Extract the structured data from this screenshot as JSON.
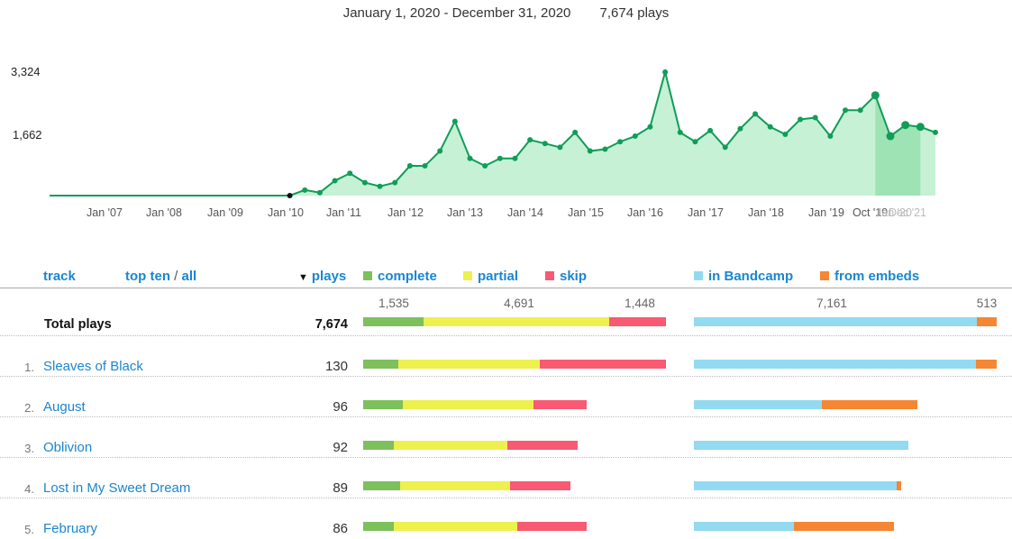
{
  "header": {
    "date_range": "January 1, 2020 - December 31, 2020",
    "plays_label": "7,674 plays"
  },
  "chart_data": {
    "type": "area",
    "y_ticks": [
      "3,324",
      "1,662"
    ],
    "x_ticks": [
      "Jan '07",
      "Jan '08",
      "Jan '09",
      "Jan '10",
      "Jan '11",
      "Jan '12",
      "Jan '13",
      "Jan '14",
      "Jan '15",
      "Jan '16",
      "Jan '17",
      "Jan '18",
      "Jan '19",
      "Oct '19"
    ],
    "x_ticks_faded": [
      "Jan '20",
      "Dec '21"
    ],
    "ylim": [
      0,
      3324
    ],
    "series": [
      {
        "values": [
          0,
          0,
          0,
          0,
          0,
          0,
          0,
          0,
          0,
          0,
          0,
          0,
          0,
          0,
          0,
          0,
          0,
          150,
          80,
          400,
          600,
          350,
          250,
          350,
          800,
          800,
          1200,
          2000,
          1000,
          800,
          1000,
          1000,
          1500,
          1400,
          1300,
          1700,
          1200,
          1250,
          1450,
          1600,
          1850,
          3324,
          1700,
          1450,
          1750,
          1300,
          1800,
          2200,
          1850,
          1650,
          2050,
          2100,
          1600,
          2300,
          2300,
          2700,
          1600,
          1900,
          1850,
          1700
        ],
        "selected_range_start_index": 55,
        "selected_range_end_index": 58,
        "color": "#0f9d58",
        "fill": "#c6f1d5",
        "selected_fill": "#9ee3b4"
      }
    ]
  },
  "table": {
    "headers": {
      "track": "track",
      "top_ten": "top ten",
      "slash": "/",
      "all": "all",
      "plays": "plays",
      "complete": "complete",
      "partial": "partial",
      "skip": "skip",
      "in_bandcamp": "in Bandcamp",
      "from_embeds": "from embeds"
    },
    "colors": {
      "complete": "#7dc05c",
      "partial": "#eef04e",
      "skip": "#f75a72",
      "in_bandcamp": "#93daf1",
      "from_embeds": "#f58634"
    },
    "totals": {
      "label": "Total plays",
      "plays": "7,674",
      "complete": "1,535",
      "partial": "4,691",
      "skip": "1,448",
      "in_bandcamp": "7,161",
      "from_embeds": "513"
    },
    "rows": [
      {
        "rank": "1.",
        "name": "Sleaves of Black",
        "plays": "130",
        "complete": 15,
        "partial": 61,
        "skip": 54,
        "bandcamp": 121,
        "embeds": 9
      },
      {
        "rank": "2.",
        "name": "August",
        "plays": "96",
        "complete": 17,
        "partial": 56,
        "skip": 23,
        "bandcamp": 55,
        "embeds": 41
      },
      {
        "rank": "3.",
        "name": "Oblivion",
        "plays": "92",
        "complete": 13,
        "partial": 49,
        "skip": 30,
        "bandcamp": 92,
        "embeds": 0
      },
      {
        "rank": "4.",
        "name": "Lost in My Sweet Dream",
        "plays": "89",
        "complete": 16,
        "partial": 47,
        "skip": 26,
        "bandcamp": 87,
        "embeds": 2
      },
      {
        "rank": "5.",
        "name": "February",
        "plays": "86",
        "complete": 13,
        "partial": 53,
        "skip": 30,
        "bandcamp": 43,
        "embeds": 43
      }
    ]
  }
}
